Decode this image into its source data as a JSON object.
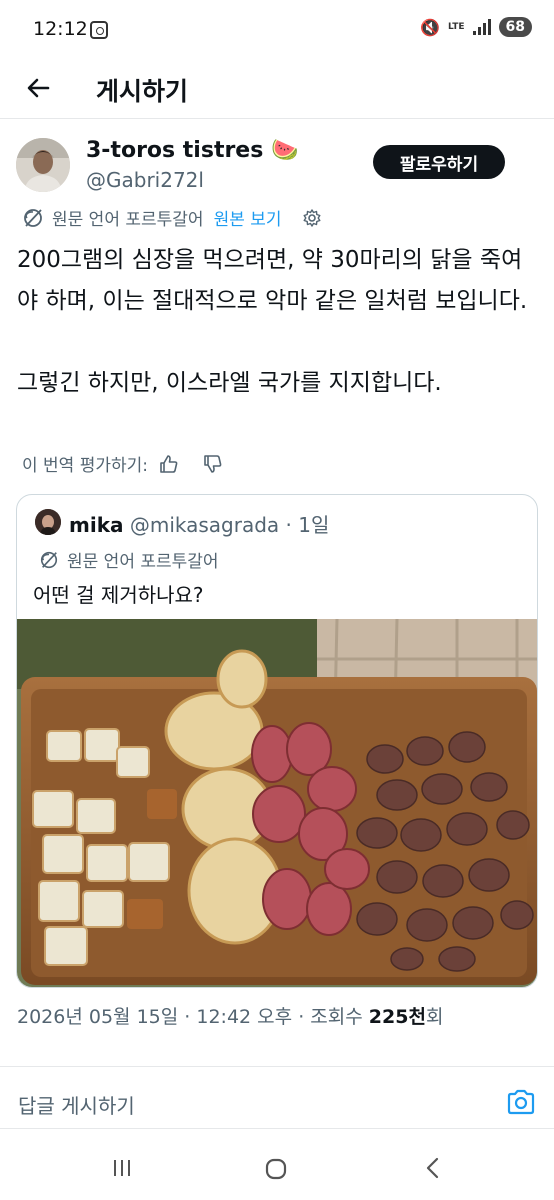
{
  "status_bar": {
    "time": "12:12",
    "network": "LTE",
    "battery": "68"
  },
  "header": {
    "title": "게시하기"
  },
  "post": {
    "author_name": "3-toros tistres 🍉",
    "author_handle": "@Gabri272l",
    "follow_label": "팔로우하기",
    "translation_notice": "원문 언어 포르투갈어",
    "show_original_label": "원본 보기",
    "text": "200그램의 심장을 먹으려면, 약 30마리의 닭을 죽여야 하며, 이는 절대적으로 악마 같은 일처럼 보입니다.\n\n그렇긴 하지만, 이스라엘 국가를 지지합니다.",
    "rate_translation_label": "이 번역 평가하기:"
  },
  "quote": {
    "author_name": "mika",
    "author_handle": "@mikasagrada",
    "separator": "·",
    "time": "1일",
    "translation_notice": "원문 언어 포르투갈어",
    "text": "어떤 걸 제거하나요?"
  },
  "meta": {
    "date": "2026년 05월 15일",
    "separator": "·",
    "time": "12:42 오후",
    "views_label": "조회수",
    "views_count": "225천",
    "views_suffix": "회"
  },
  "reply": {
    "placeholder": "답글 게시하기"
  },
  "colors": {
    "accent_blue": "#1d9bf0",
    "text_primary": "#0f1419",
    "text_secondary": "#536471",
    "follow_button_bg": "#0f1419"
  },
  "icons": [
    "back-arrow-icon",
    "globe-slash-icon",
    "gear-icon",
    "thumbs-up-icon",
    "thumbs-down-icon",
    "camera-icon",
    "recent-apps-icon",
    "home-icon",
    "nav-back-icon"
  ]
}
